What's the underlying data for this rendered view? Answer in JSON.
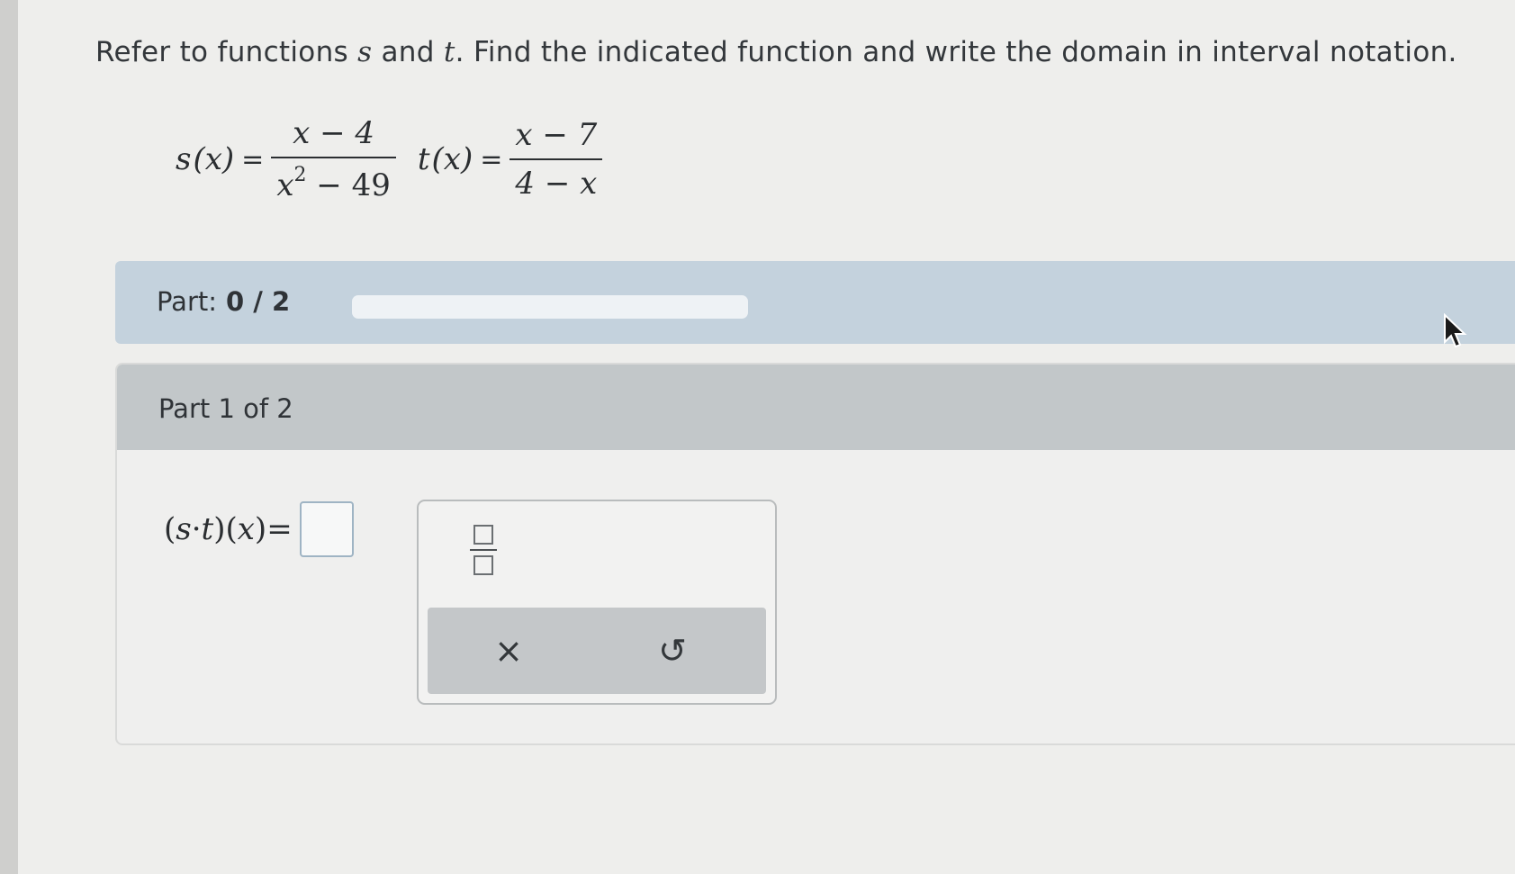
{
  "question": {
    "text_before": "Refer to functions",
    "var_s": "s",
    "text_and": "and",
    "var_t": "t",
    "text_after": ". Find the indicated function and write the domain in interval notation."
  },
  "functions": {
    "s": {
      "name": "s",
      "arg": "(x)",
      "equals": "=",
      "numerator": "x − 4",
      "den_base": "x",
      "den_exp": "2",
      "den_rest": " − 49"
    },
    "t": {
      "name": "t",
      "arg": "(x)",
      "equals": "=",
      "numerator": "x − 7",
      "denominator": "4 − x"
    }
  },
  "progress": {
    "label": "Part:",
    "value": "0 / 2",
    "fraction": 0.0
  },
  "part": {
    "header": "Part 1 of 2",
    "answer_prefix_open": "(",
    "answer_s": "s",
    "answer_dot": "·",
    "answer_t": "t",
    "answer_mid": ")(",
    "answer_x": "x",
    "answer_close": ")",
    "answer_equals": "=",
    "answer_value": ""
  },
  "palette": {
    "fraction_tool": "fraction-template-icon",
    "clear_icon": "×",
    "undo_icon": "↺"
  },
  "colors": {
    "progress_bg": "#c4d2dd",
    "header_bg": "#c2c7c9",
    "input_border": "#9fb4c4"
  }
}
